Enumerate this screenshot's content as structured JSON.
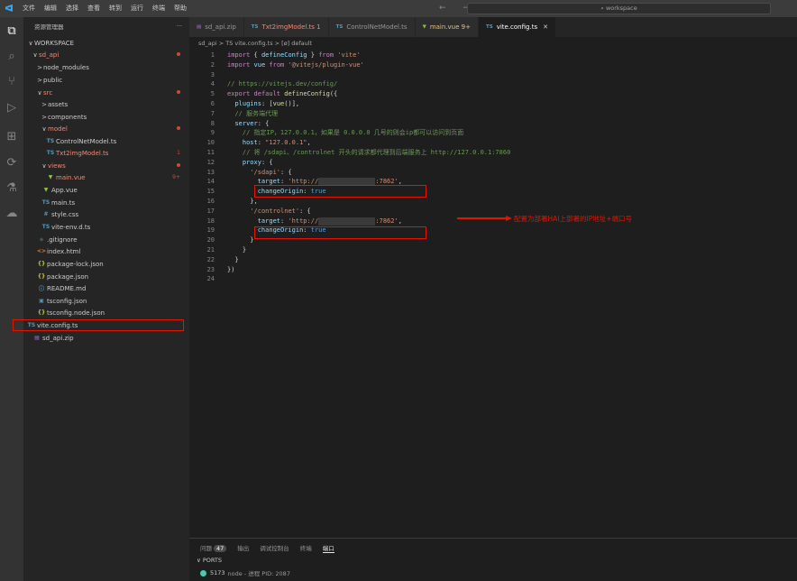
{
  "titlebar": {
    "logo": "ᐊ",
    "menu": [
      "文件",
      "编辑",
      "选择",
      "查看",
      "转到",
      "运行",
      "终端",
      "帮助"
    ],
    "nav": "← →",
    "search": "⌕ workspace"
  },
  "sidebar": {
    "title": "资源管理器",
    "more": "···",
    "items": [
      {
        "label": "WORKSPACE",
        "chev": "∨",
        "icon": "",
        "indent": 0
      },
      {
        "label": "sd_api",
        "chev": "∨",
        "icon": "",
        "indent": 1,
        "red": true
      },
      {
        "label": "node_modules",
        "chev": ">",
        "icon": "",
        "indent": 2
      },
      {
        "label": "public",
        "chev": ">",
        "icon": "",
        "indent": 2
      },
      {
        "label": "src",
        "chev": "∨",
        "icon": "",
        "indent": 2,
        "red": true
      },
      {
        "label": "assets",
        "chev": ">",
        "icon": "",
        "indent": 3
      },
      {
        "label": "components",
        "chev": ">",
        "icon": "",
        "indent": 3
      },
      {
        "label": "model",
        "chev": "∨",
        "icon": "",
        "indent": 3,
        "red": true
      },
      {
        "label": "ControlNetModel.ts",
        "chev": "",
        "icon": "TS",
        "indent": 4
      },
      {
        "label": "Txt2imgModel.ts",
        "chev": "",
        "icon": "TS",
        "indent": 4,
        "red": true,
        "badge": "1"
      },
      {
        "label": "views",
        "chev": "∨",
        "icon": "",
        "indent": 3,
        "red": true
      },
      {
        "label": "main.vue",
        "chev": "",
        "icon": "▼",
        "indent": 4,
        "red": true,
        "badge": "9+"
      },
      {
        "label": "App.vue",
        "chev": "",
        "icon": "▼",
        "indent": 3
      },
      {
        "label": "main.ts",
        "chev": "",
        "icon": "TS",
        "indent": 3
      },
      {
        "label": "style.css",
        "chev": "",
        "icon": "#",
        "indent": 3
      },
      {
        "label": "vite-env.d.ts",
        "chev": "",
        "icon": "TS",
        "indent": 3
      },
      {
        "label": ".gitignore",
        "chev": "",
        "icon": "◆",
        "indent": 2
      },
      {
        "label": "index.html",
        "chev": "",
        "icon": "<>",
        "indent": 2
      },
      {
        "label": "package-lock.json",
        "chev": "",
        "icon": "{}",
        "indent": 2
      },
      {
        "label": "package.json",
        "chev": "",
        "icon": "{}",
        "indent": 2
      },
      {
        "label": "README.md",
        "chev": "",
        "icon": "ⓘ",
        "indent": 2
      },
      {
        "label": "tsconfig.json",
        "chev": "",
        "icon": "▣",
        "indent": 2
      },
      {
        "label": "tsconfig.node.json",
        "chev": "",
        "icon": "{}",
        "indent": 2
      },
      {
        "label": "vite.config.ts",
        "chev": "",
        "icon": "TS",
        "indent": 2,
        "selected": true
      },
      {
        "label": "sd_api.zip",
        "chev": "",
        "icon": "▤",
        "indent": 1
      }
    ]
  },
  "tabs": [
    {
      "label": "sd_api.zip",
      "icon": "▤",
      "active": false
    },
    {
      "label": "Txt2imgModel.ts 1",
      "icon": "TS",
      "active": false,
      "red": true
    },
    {
      "label": "ControlNetModel.ts",
      "icon": "TS",
      "active": false
    },
    {
      "label": "main.vue 9+",
      "icon": "▼",
      "active": false,
      "red": true
    },
    {
      "label": "vite.config.ts",
      "icon": "TS",
      "active": true,
      "close": "✕"
    }
  ],
  "breadcrumb": "sd_api > TS vite.config.ts > [ø] default",
  "code": [
    {
      "n": "1",
      "html": "<span class=\"k\">import</span> <span class=\"b\">{ </span><span class=\"p\">defineConfig</span><span class=\"b\"> } </span><span class=\"k\">from</span> <span class=\"s\">'vite'</span>"
    },
    {
      "n": "2",
      "html": "<span class=\"k\">import</span> <span class=\"p\">vue</span> <span class=\"k\">from</span> <span class=\"s\">'@vitejs/plugin-vue'</span>"
    },
    {
      "n": "3",
      "html": ""
    },
    {
      "n": "4",
      "html": "<span class=\"c\">// https://vitejs.dev/config/</span>"
    },
    {
      "n": "5",
      "html": "<span class=\"k\">export</span> <span class=\"k\">default</span> <span class=\"f\">defineConfig</span><span class=\"b\">({</span>"
    },
    {
      "n": "6",
      "html": "  <span class=\"p\">plugins</span><span class=\"b\">: [</span><span class=\"f\">vue</span><span class=\"b\">()],</span>"
    },
    {
      "n": "7",
      "html": "  <span class=\"c\">// 服务端代理</span>"
    },
    {
      "n": "8",
      "html": "  <span class=\"p\">server</span><span class=\"b\">: {</span>"
    },
    {
      "n": "9",
      "html": "    <span class=\"c\">// 指定IP，127.0.0.1，如果是 0.0.0.0 几号的则会ip都可以访问到页面</span>"
    },
    {
      "n": "10",
      "html": "    <span class=\"p\">host</span><span class=\"b\">: </span><span class=\"s\">\"127.0.0.1\"</span><span class=\"b\">,</span>"
    },
    {
      "n": "11",
      "html": "    <span class=\"c\">// 将 /sdapi、/controlnet 开头的请求都代理到后端服务上 http://127.0.0.1:7860</span>"
    },
    {
      "n": "12",
      "html": "    <span class=\"p\">proxy</span><span class=\"b\">: {</span>"
    },
    {
      "n": "13",
      "html": "      <span class=\"s\">'/sdapi'</span><span class=\"b\">: {</span>"
    },
    {
      "n": "14",
      "html": "        <span class=\"p\">target</span><span class=\"b\">: </span><span class=\"s\">'http://</span><span class=\"blur\">xxx.xxx.xxx.xxx</span><span class=\"s\">:7862'</span><span class=\"b\">,</span>"
    },
    {
      "n": "15",
      "html": "        <span class=\"p\">changeOrigin</span><span class=\"b\">: </span><span class=\"kw\">true</span>"
    },
    {
      "n": "16",
      "html": "      <span class=\"b\">},</span>"
    },
    {
      "n": "17",
      "html": "      <span class=\"s\">'/controlnet'</span><span class=\"b\">: {</span>"
    },
    {
      "n": "18",
      "html": "        <span class=\"p\">target</span><span class=\"b\">: </span><span class=\"s\">'http://</span><span class=\"blur\">xxx.xxx.xxx.xxx</span><span class=\"s\">:7862'</span><span class=\"b\">,</span>"
    },
    {
      "n": "19",
      "html": "        <span class=\"p\">changeOrigin</span><span class=\"b\">: </span><span class=\"kw\">true</span>"
    },
    {
      "n": "20",
      "html": "      <span class=\"b\">}</span>"
    },
    {
      "n": "21",
      "html": "    <span class=\"b\">}</span>"
    },
    {
      "n": "22",
      "html": "  <span class=\"b\">}</span>"
    },
    {
      "n": "23",
      "html": "<span class=\"b\">})</span>"
    },
    {
      "n": "24",
      "html": ""
    }
  ],
  "annotation": "配置为部署HAI上部署的IP地址+端口号",
  "panel": {
    "tabs": [
      "问题",
      "输出",
      "调试控制台",
      "终端",
      "端口"
    ],
    "problem_count": "47",
    "ports_label": "∨ PORTS",
    "port": "5173",
    "port_sub": "node - 进程 PID: 2087"
  }
}
